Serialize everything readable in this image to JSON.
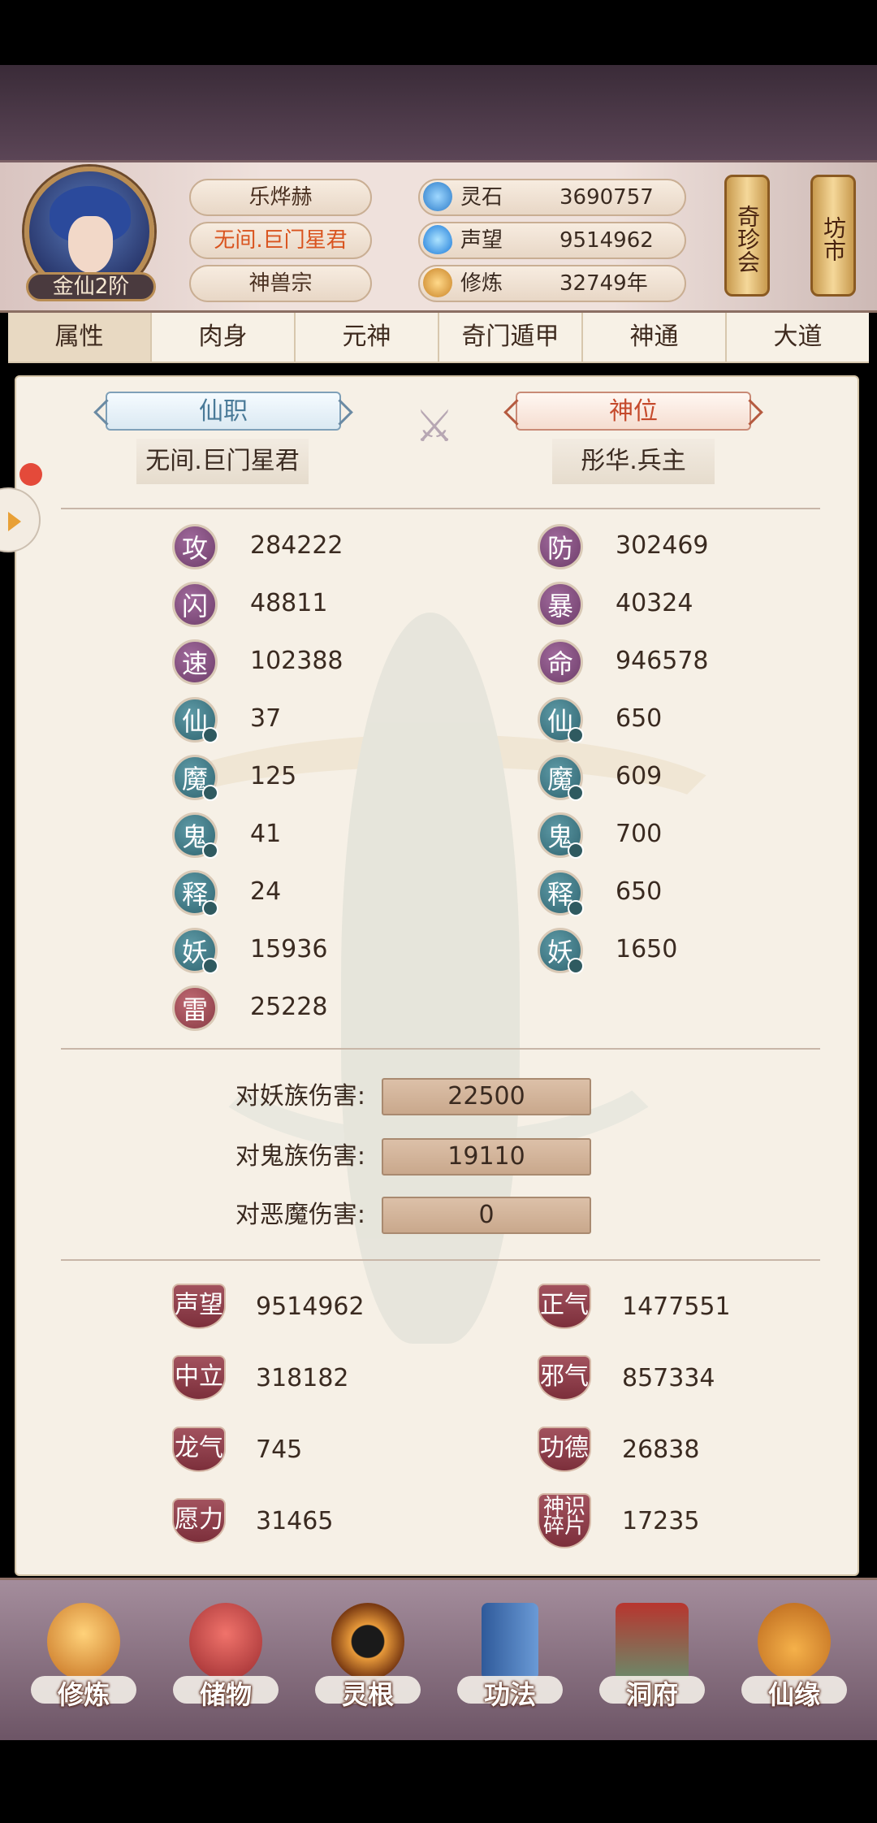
{
  "player": {
    "name": "乐烨赫",
    "title": "无间.巨门星君",
    "sect": "神兽宗",
    "rank": "金仙2阶"
  },
  "resources": [
    {
      "icon": "spirit-stone-icon",
      "label": "灵石",
      "value": "3690757"
    },
    {
      "icon": "reputation-icon",
      "label": "声望",
      "value": "9514962"
    },
    {
      "icon": "cultivation-icon",
      "label": "修炼",
      "value": "32749年"
    }
  ],
  "shops": {
    "treasure": "奇珍会",
    "market": "坊市"
  },
  "tabs": [
    "属性",
    "肉身",
    "元神",
    "奇门遁甲",
    "神通",
    "大道"
  ],
  "positions": {
    "immortal_job_label": "仙职",
    "immortal_job_value": "无间.巨门星君",
    "divine_rank_label": "神位",
    "divine_rank_value": "彤华.兵主"
  },
  "attributes_left": [
    {
      "glyph": "攻",
      "value": "284222"
    },
    {
      "glyph": "闪",
      "value": "48811"
    },
    {
      "glyph": "速",
      "value": "102388"
    },
    {
      "glyph": "仙",
      "value": "37"
    },
    {
      "glyph": "魔",
      "value": "125"
    },
    {
      "glyph": "鬼",
      "value": "41"
    },
    {
      "glyph": "释",
      "value": "24"
    },
    {
      "glyph": "妖",
      "value": "15936"
    },
    {
      "glyph": "雷",
      "value": "25228"
    }
  ],
  "attributes_right": [
    {
      "glyph": "防",
      "value": "302469"
    },
    {
      "glyph": "暴",
      "value": "40324"
    },
    {
      "glyph": "命",
      "value": "946578"
    },
    {
      "glyph": "仙",
      "value": "650"
    },
    {
      "glyph": "魔",
      "value": "609"
    },
    {
      "glyph": "鬼",
      "value": "700"
    },
    {
      "glyph": "释",
      "value": "650"
    },
    {
      "glyph": "妖",
      "value": "1650"
    }
  ],
  "damage": [
    {
      "label": "对妖族伤害:",
      "value": "22500"
    },
    {
      "label": "对鬼族伤害:",
      "value": "19110"
    },
    {
      "label": "对恶魔伤害:",
      "value": "0"
    }
  ],
  "karma_left": [
    {
      "label": "声望",
      "value": "9514962"
    },
    {
      "label": "中立",
      "value": "318182"
    },
    {
      "label": "龙气",
      "value": "745"
    },
    {
      "label": "愿力",
      "value": "31465"
    }
  ],
  "karma_right": [
    {
      "label": "正气",
      "value": "1477551"
    },
    {
      "label": "邪气",
      "value": "857334"
    },
    {
      "label": "功德",
      "value": "26838"
    },
    {
      "label": "神识碎片",
      "value": "17235"
    }
  ],
  "nav": [
    {
      "label": "修炼",
      "icon": "cultivate-icon",
      "color": "#e0a14a"
    },
    {
      "label": "储物",
      "icon": "bag-icon",
      "color": "#c8444a"
    },
    {
      "label": "灵根",
      "icon": "spirit-root-icon",
      "color": "#b8742a"
    },
    {
      "label": "功法",
      "icon": "book-icon",
      "color": "#4a78b8"
    },
    {
      "label": "洞府",
      "icon": "cave-icon",
      "color": "#6a9a72"
    },
    {
      "label": "仙缘",
      "icon": "gourd-icon",
      "color": "#d8962e"
    }
  ]
}
